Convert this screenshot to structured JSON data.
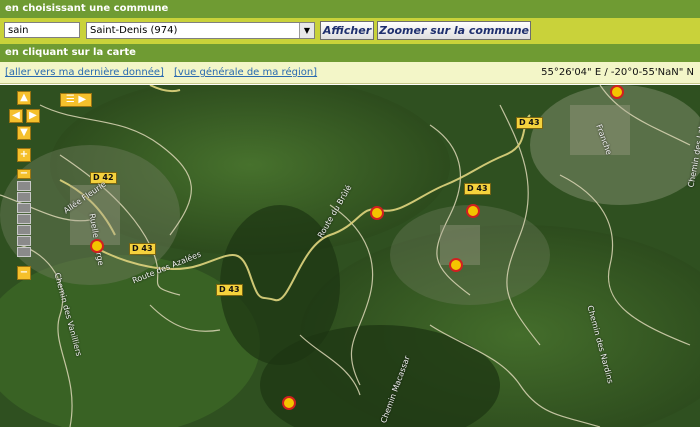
{
  "header": {
    "by_commune": "en choisissant une commune",
    "by_map": "en cliquant sur la carte"
  },
  "search": {
    "input_value": "sain",
    "selected_commune": "Saint-Denis (974)",
    "show_button": "Afficher",
    "zoom_button": "Zoomer sur la commune"
  },
  "links": {
    "last_data": "[aller vers ma dernière donnée]",
    "region_view": "[vue générale de ma région]"
  },
  "coordinates": "55°26'04\" E / -20°0-55'NaN\" N",
  "map": {
    "road_labels": [
      "D 43",
      "D 42",
      "D 43",
      "D 43",
      "D 43"
    ],
    "street_labels": [
      "Allée Fleurie",
      "Route des Azalées",
      "Route du Brûlé",
      "Chemin des Nardins",
      "Chemin Macassar",
      "Ruelle Vierge",
      "Chemin des Vanilliers",
      "Franche",
      "Chemin des Lataniers"
    ],
    "marker_count": 8,
    "colors": {
      "marker_fill": "#f4c400",
      "marker_border": "#d02020",
      "road": "#e0d27a"
    }
  }
}
